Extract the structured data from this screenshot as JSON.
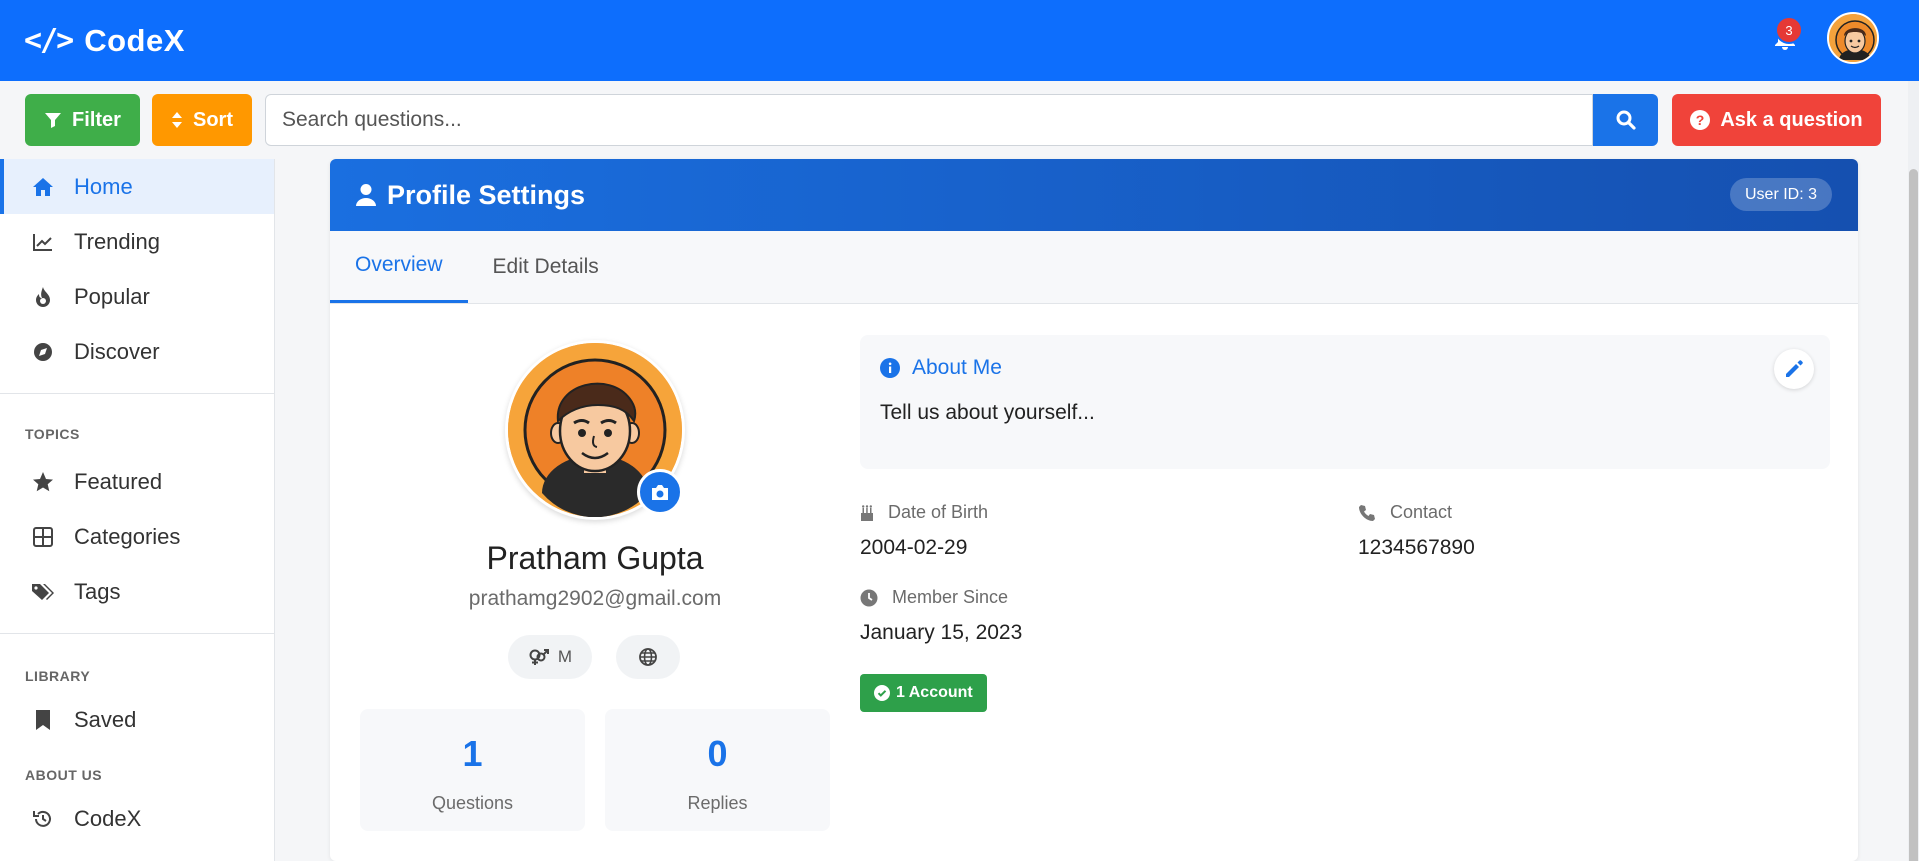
{
  "app": {
    "name": "CodeX",
    "logo_glyph": "</>",
    "notification_count": "3"
  },
  "toolbar": {
    "filter_label": "Filter",
    "sort_label": "Sort",
    "search_placeholder": "Search questions...",
    "ask_label": "Ask a question"
  },
  "sidebar": {
    "main": [
      {
        "label": "Home",
        "icon": "home-icon",
        "active": true
      },
      {
        "label": "Trending",
        "icon": "trending-icon"
      },
      {
        "label": "Popular",
        "icon": "fire-icon"
      },
      {
        "label": "Discover",
        "icon": "compass-icon"
      }
    ],
    "topics_heading": "TOPICS",
    "topics": [
      {
        "label": "Featured",
        "icon": "star-icon"
      },
      {
        "label": "Categories",
        "icon": "grid-icon"
      },
      {
        "label": "Tags",
        "icon": "tags-icon"
      }
    ],
    "library_heading": "LIBRARY",
    "library": [
      {
        "label": "Saved",
        "icon": "bookmark-icon"
      }
    ],
    "about_heading": "ABOUT US",
    "about": [
      {
        "label": "CodeX",
        "icon": "history-icon"
      }
    ]
  },
  "profile": {
    "header_title": "Profile Settings",
    "user_id": "User ID: 3",
    "tabs": [
      {
        "label": "Overview",
        "active": true
      },
      {
        "label": "Edit Details"
      }
    ],
    "name": "Pratham Gupta",
    "email": "prathamg2902@gmail.com",
    "gender": "M",
    "stats": [
      {
        "value": "1",
        "label": "Questions"
      },
      {
        "value": "0",
        "label": "Replies"
      }
    ],
    "about_title": "About Me",
    "about_text": "Tell us about yourself...",
    "dob_label": "Date of Birth",
    "dob_value": "2004-02-29",
    "contact_label": "Contact",
    "contact_value": "1234567890",
    "member_label": "Member Since",
    "member_value": "January 15, 2023",
    "account_badge": "1 Account"
  },
  "colors": {
    "primary": "#0d6efd",
    "accent_blue": "#1a73e8",
    "filter_green": "#3fae49",
    "sort_orange": "#ff9800",
    "ask_red": "#f0433a",
    "badge_green": "#2ea04a"
  }
}
